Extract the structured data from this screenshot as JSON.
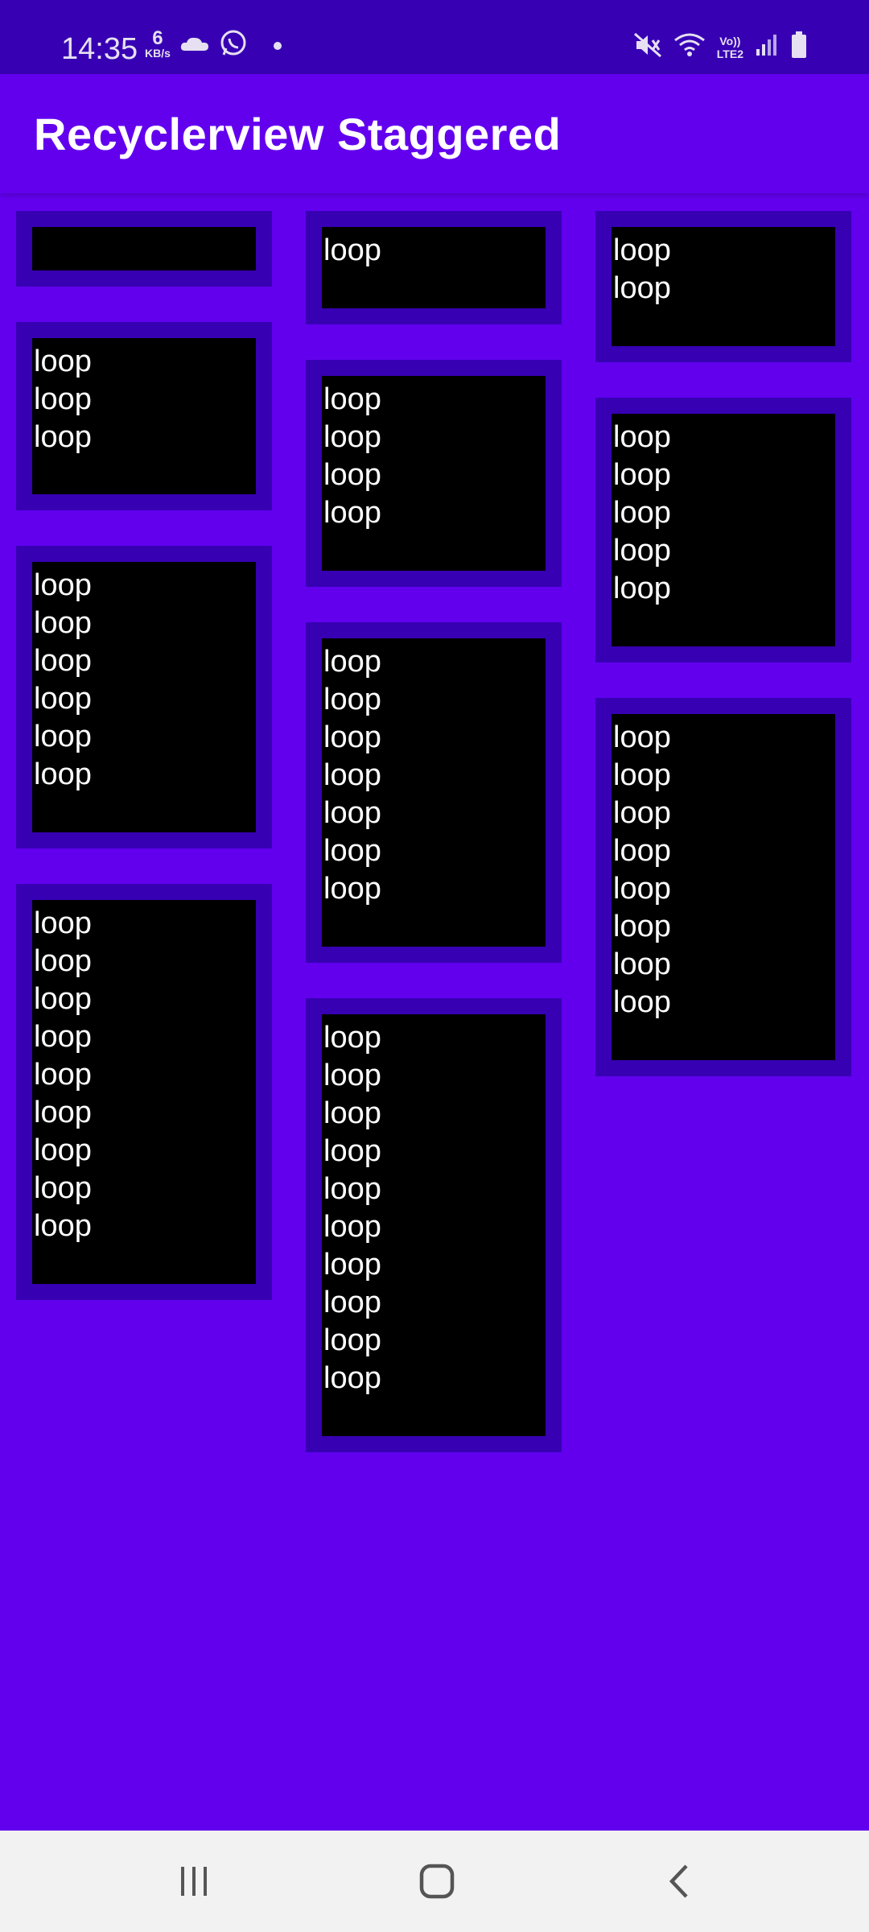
{
  "status_bar": {
    "time": "14:35",
    "net_speed_value": "6",
    "net_speed_unit": "KB/s",
    "network_label_top": "Vo))",
    "network_label_bottom": "LTE2",
    "icons": [
      "cloud-icon",
      "whatsapp-icon",
      "notification-dot",
      "mute-icon",
      "wifi-icon",
      "signal-icon",
      "battery-icon"
    ]
  },
  "app_bar": {
    "title": "Recyclerview Staggered"
  },
  "grid": {
    "columns": [
      {
        "items": [
          {
            "text": ""
          },
          {
            "text": "loop\nloop\nloop"
          },
          {
            "text": "loop\nloop\nloop\nloop\nloop\nloop"
          },
          {
            "text": "loop\nloop\nloop\nloop\nloop\nloop\nloop\nloop\nloop"
          }
        ]
      },
      {
        "items": [
          {
            "text": "loop"
          },
          {
            "text": "loop\nloop\nloop\nloop"
          },
          {
            "text": "loop\nloop\nloop\nloop\nloop\nloop\nloop"
          },
          {
            "text": "loop\nloop\nloop\nloop\nloop\nloop\nloop\nloop\nloop\nloop"
          }
        ]
      },
      {
        "items": [
          {
            "text": "loop\nloop"
          },
          {
            "text": "loop\nloop\nloop\nloop\nloop"
          },
          {
            "text": "loop\nloop\nloop\nloop\nloop\nloop\nloop\nloop"
          }
        ]
      }
    ]
  },
  "colors": {
    "primary": "#6200EE",
    "primary_dark": "#3700B3",
    "card_inner": "#000000",
    "text": "#FFFFFF",
    "nav_bar": "#F2F2F2"
  },
  "nav_bar": {
    "icons": [
      "recents-icon",
      "home-icon",
      "back-icon"
    ]
  }
}
